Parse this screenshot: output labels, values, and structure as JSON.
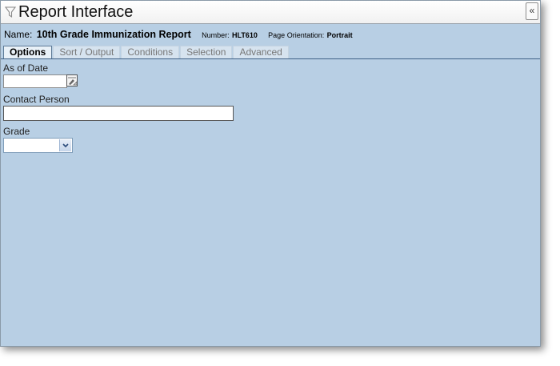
{
  "window": {
    "title": "Report Interface",
    "collapse_label": "«"
  },
  "report": {
    "name_label": "Name:",
    "name": "10th Grade Immunization Report",
    "number_label": "Number:",
    "number": "HLT610",
    "orientation_label": "Page Orientation:",
    "orientation": "Portrait"
  },
  "tabs": [
    {
      "label": "Options",
      "active": true
    },
    {
      "label": "Sort / Output",
      "active": false
    },
    {
      "label": "Conditions",
      "active": false
    },
    {
      "label": "Selection",
      "active": false
    },
    {
      "label": "Advanced",
      "active": false
    }
  ],
  "form": {
    "as_of_date": {
      "label": "As of Date",
      "value": ""
    },
    "contact_person": {
      "label": "Contact Person",
      "value": ""
    },
    "grade": {
      "label": "Grade",
      "selected": ""
    }
  },
  "colors": {
    "panel_bg": "#b8cfe4",
    "tab_line": "#3f6187"
  }
}
